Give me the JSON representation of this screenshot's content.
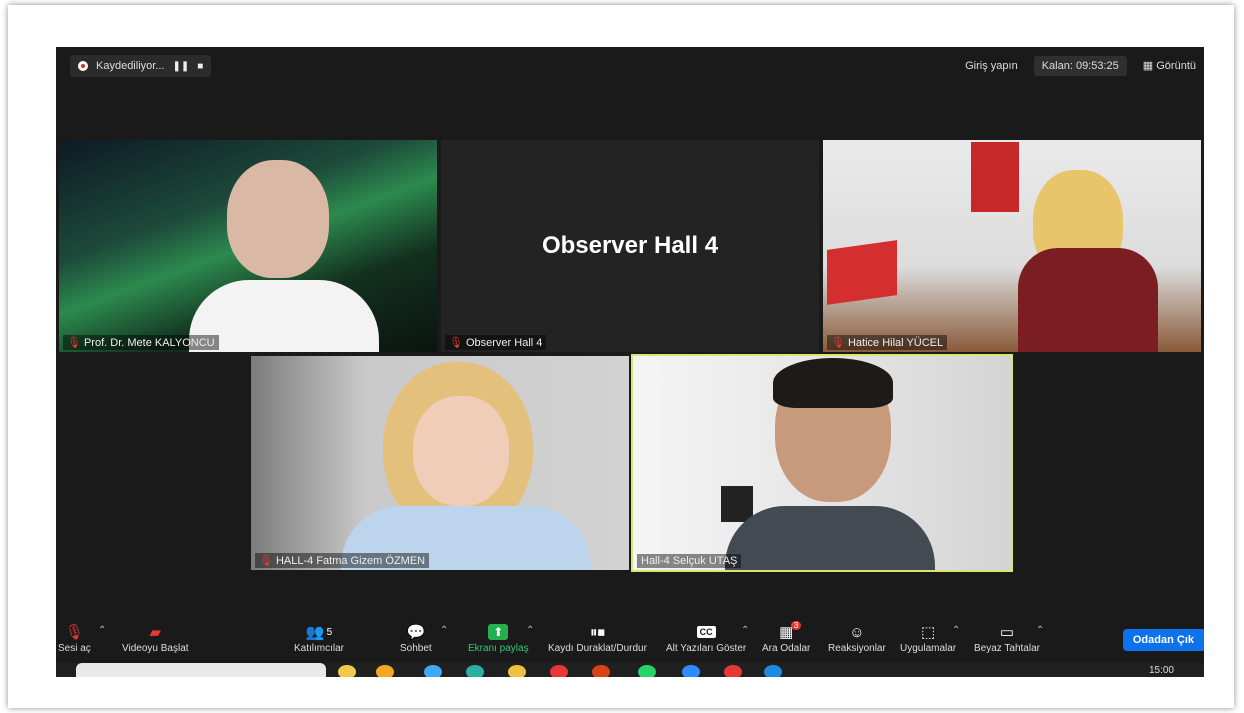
{
  "recording": {
    "label": "Kaydediliyor...",
    "pause": "❚❚",
    "stop": "■"
  },
  "topbar": {
    "signin": "Giriş yapın",
    "timer": "Kalan: 09:53:25",
    "view": "Görüntü"
  },
  "tiles": [
    {
      "name": "Prof. Dr. Mete KALYONCU",
      "muted": true
    },
    {
      "name": "Observer Hall 4",
      "muted": true,
      "center_text": "Observer Hall 4"
    },
    {
      "name": "Hatice Hilal YÜCEL",
      "muted": true
    },
    {
      "name": "HALL-4 Fatma Gizem ÖZMEN",
      "muted": true
    },
    {
      "name": "Hall-4 Selçuk UTAŞ",
      "muted": false,
      "active_speaker": true
    }
  ],
  "toolbar": {
    "unmute": "Sesi aç",
    "video": "Videoyu Başlat",
    "participants": "Katılımcılar",
    "participants_count": "5",
    "chat": "Sohbet",
    "share": "Ekranı paylaş",
    "record": "Kaydı Duraklat/Durdur",
    "captions": "Alt Yazıları Göster",
    "breakout": "Ara Odalar",
    "breakout_badge": "3",
    "reactions": "Reaksiyonlar",
    "apps": "Uygulamalar",
    "whiteboard": "Beyaz Tahtalar",
    "leave": "Odadan Çık"
  },
  "taskbar": {
    "time": "15:00"
  },
  "colors": {
    "active_border": "#d9e66a",
    "leave_btn": "#0e72ed",
    "share_green": "#23b14d",
    "mute_red": "#e53935"
  }
}
